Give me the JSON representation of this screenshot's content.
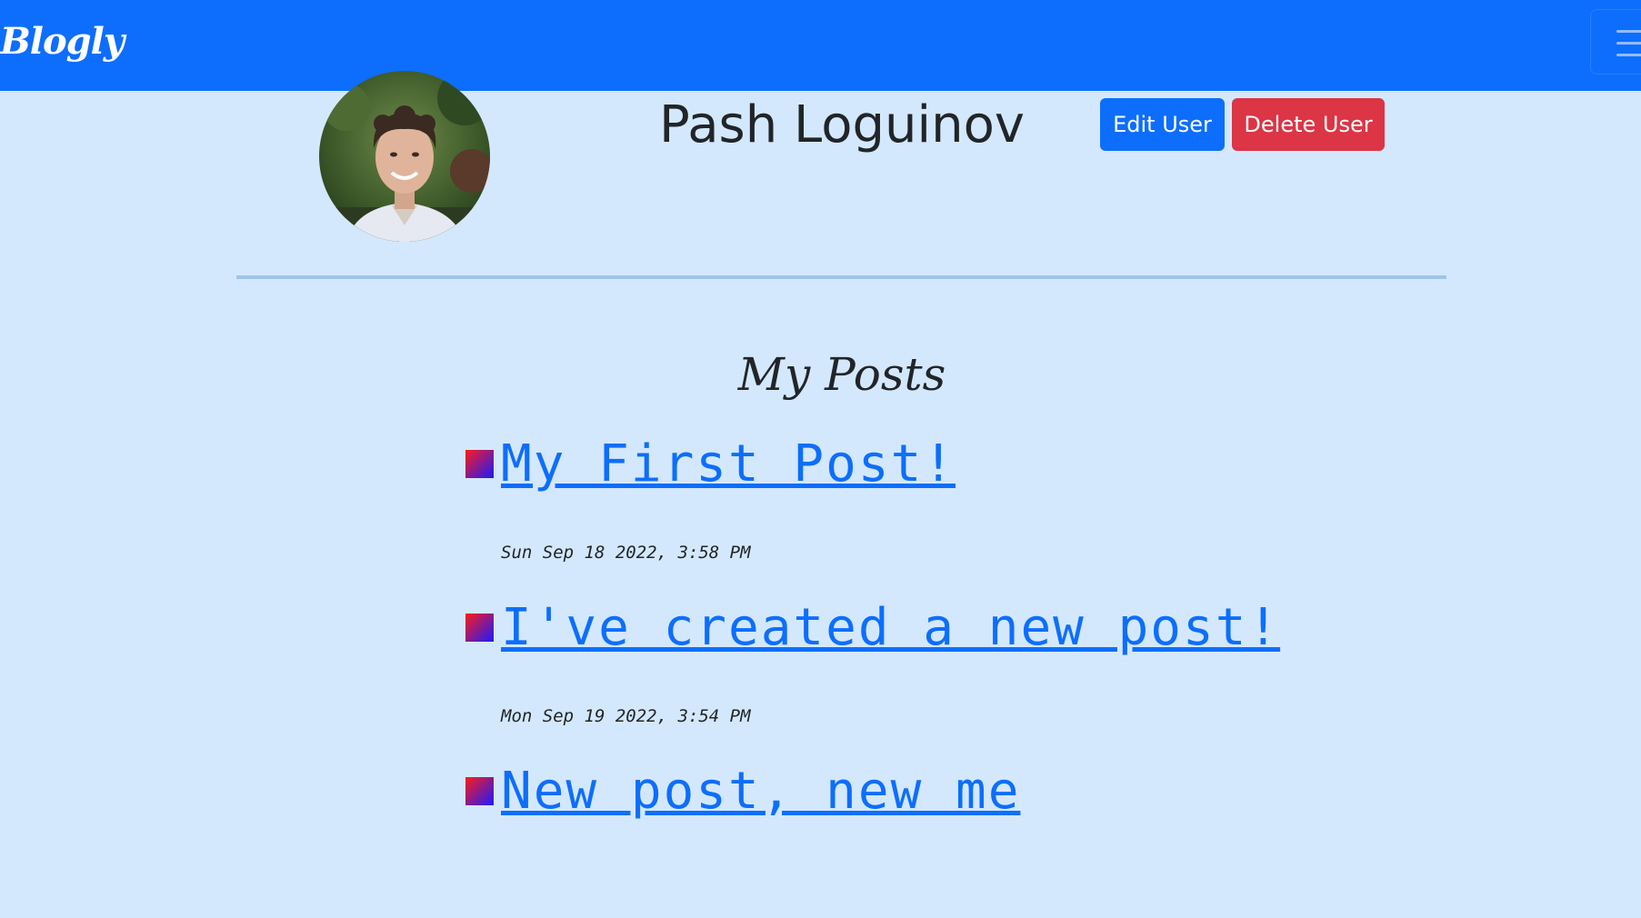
{
  "navbar": {
    "brand": "Blogly",
    "toggle_icon": "hamburger-menu-icon"
  },
  "user": {
    "name": "Pash Loguinov",
    "avatar_alt": "Pash Loguinov"
  },
  "actions": {
    "edit_label": "Edit User",
    "delete_label": "Delete User"
  },
  "posts": {
    "heading": "My Posts",
    "bullet_icon": "gradient-square-bullet-icon",
    "items": [
      {
        "title": "My First Post!",
        "date": "Sun Sep 18 2022, 3:58 PM"
      },
      {
        "title": "I've created a new post!",
        "date": "Mon Sep 19 2022, 3:54 PM"
      },
      {
        "title": "New post, new me",
        "date": ""
      }
    ]
  },
  "colors": {
    "navbar": "#0d6efd",
    "page_background": "#d4e8fd",
    "primary": "#0d6efd",
    "danger": "#dc3545",
    "link": "#0d6efd"
  }
}
